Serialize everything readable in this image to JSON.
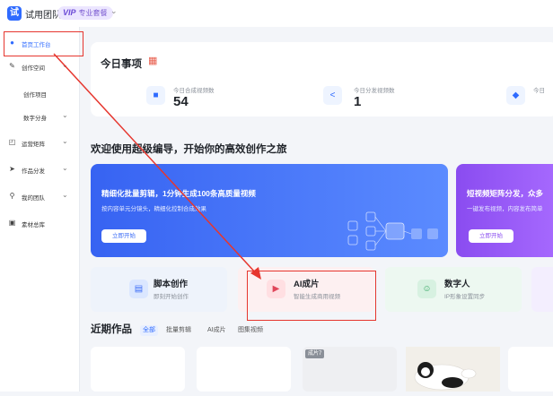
{
  "header": {
    "logo_glyph": "试",
    "team_name": "试用团队",
    "vip_mark": "VIP",
    "vip_plan": "专业套餐"
  },
  "sidebar": {
    "items": [
      {
        "label": "首页工作台",
        "active": true,
        "icon": "home-icon"
      },
      {
        "label": "创作空间",
        "icon": "edit-icon",
        "expandable": true
      },
      {
        "label": "创作项目",
        "sub": true
      },
      {
        "label": "数字分身",
        "sub": true,
        "expandable": true
      },
      {
        "label": "运营矩阵",
        "icon": "bag-icon",
        "expandable": true
      },
      {
        "label": "作品分发",
        "icon": "send-icon",
        "expandable": true
      },
      {
        "label": "我的团队",
        "icon": "person-icon",
        "expandable": true
      },
      {
        "label": "素材总库",
        "icon": "library-icon"
      }
    ]
  },
  "today": {
    "title": "今日事项",
    "stats": [
      {
        "label": "今日合成视频数",
        "value": "54",
        "icon": "folder-icon"
      },
      {
        "label": "今日分发视频数",
        "value": "1",
        "icon": "share-icon"
      },
      {
        "label": "今日",
        "value": "",
        "icon": "box-icon"
      }
    ]
  },
  "welcome": "欢迎使用超级编导，开始你的高效创作之旅",
  "banners": [
    {
      "title": "精细化批量剪辑，1分钟生成100条高质量视频",
      "subtitle": "按内容单元分镜头，精细化控制合成效果",
      "button": "立即开始",
      "color": "#3b6cf6"
    },
    {
      "title": "短视频矩阵分发，众多",
      "subtitle": "一键发布视频，内容发布简单",
      "button": "立即开始",
      "color": "#8b4ff0"
    }
  ],
  "tiles": [
    {
      "title": "脚本创作",
      "subtitle": "即刻开始创作",
      "icon": "script-icon"
    },
    {
      "title": "AI成片",
      "subtitle": "智能生成商用视频",
      "icon": "ai-video-icon"
    },
    {
      "title": "数字人",
      "subtitle": "IP形象设置同步",
      "icon": "digital-human-icon"
    }
  ],
  "works": {
    "title": "近期作品",
    "filters": [
      "全部",
      "批量剪辑",
      "AI成片",
      "图集视频"
    ],
    "thumb_tag": "成片7"
  },
  "colors": {
    "accent": "#2f6bff",
    "highlight": "#e6362e"
  }
}
